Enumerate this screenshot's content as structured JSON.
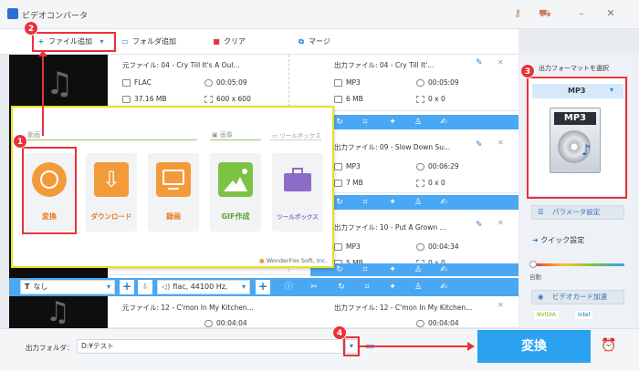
{
  "app": {
    "title": "ビデオコンバータ"
  },
  "toolbar": {
    "add_file": "ファイル追加",
    "add_folder": "フォルダ追加",
    "clear": "クリア",
    "merge": "マージ"
  },
  "files": [
    {
      "source_name": "元ファイル: 04 - Cry Till It's A Oul...",
      "source_format": "FLAC",
      "source_duration": "00:05:09",
      "source_size": "37.16 MB",
      "source_res": "600 x 600",
      "output_name": "出力ファイル: 04 - Cry Till It'...",
      "output_format": "MP3",
      "output_duration": "00:05:09",
      "output_size": "6 MB",
      "output_res": "0 x 0"
    },
    {
      "output_name": "出力ファイル: 09 - Slow Down Su...",
      "output_format": "MP3",
      "output_duration": "00:06:29",
      "output_size": "7 MB",
      "output_res": "0 x 0"
    },
    {
      "output_name": "出力ファイル: 10 - Put A Grown ...",
      "output_format": "MP3",
      "output_duration": "00:04:34",
      "output_size": "5 MB",
      "output_res": "0 x 0"
    },
    {
      "source_name": "元ファイル: 12 - C'mon In My Kitchen...",
      "source_duration": "00:04:04",
      "output_name": "出力ファイル: 12 - C'mon In My Kitchen...",
      "output_duration": "00:04:04"
    }
  ],
  "popup": {
    "cat_video": "動画",
    "cat_image": "画像",
    "cat_tools": "ツールボックス",
    "tiles": [
      "変換",
      "ダウンロード",
      "録画",
      "GIF作成",
      "ツールボックス"
    ],
    "footer": "WonderFox Soft, Inc."
  },
  "controls": {
    "subtitle": "なし",
    "audio": "flac, 44100 Hz,"
  },
  "side": {
    "format_label": "出力フォーマットを選択",
    "format_value": "MP3",
    "icon_text": "MP3",
    "param_btn": "パラメータ設定",
    "quick_label": "クイック設定",
    "auto_label": "自動",
    "gpu_btn": "ビデオカード加速",
    "gpu_brands": [
      "NVIDIA",
      "intel"
    ]
  },
  "bottom": {
    "folder_label": "出力フォルダ：",
    "folder_value": "D:¥テスト",
    "convert_label": "変換"
  },
  "badges": [
    "1",
    "2",
    "3",
    "4"
  ],
  "colors": {
    "accent": "#2aa2f0",
    "highlight_red": "#e8323a",
    "highlight_yellow": "#e6e21d",
    "tile_orange": "#f39a3b",
    "tile_green": "#7cc243",
    "tile_purple": "#8c6bc8"
  }
}
